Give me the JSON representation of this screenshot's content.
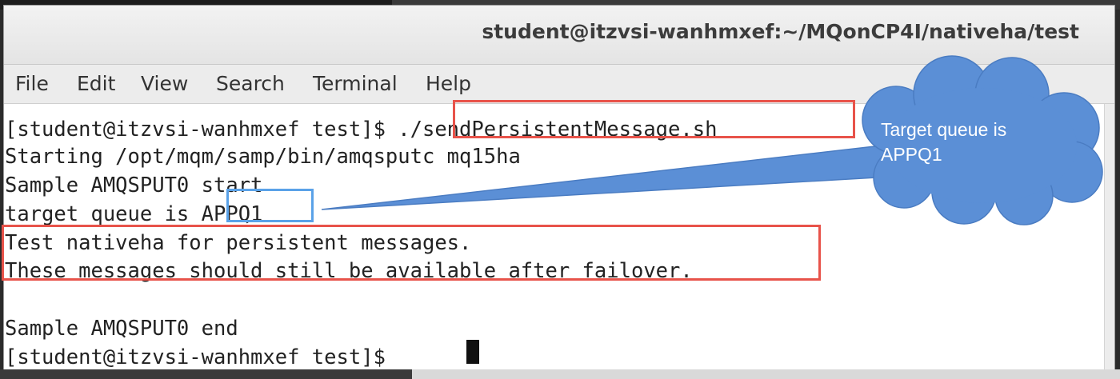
{
  "window": {
    "title": "student@itzvsi-wanhmxef:~/MQonCP4I/nativeha/test"
  },
  "menu": [
    "File",
    "Edit",
    "View",
    "Search",
    "Terminal",
    "Help"
  ],
  "terminal": {
    "lines": [
      "[student@itzvsi-wanhmxef test]$ ./sendPersistentMessage.sh",
      "Starting /opt/mqm/samp/bin/amqsputc mq15ha",
      "Sample AMQSPUT0 start",
      "target queue is APPQ1",
      "Test nativeha for persistent messages.",
      "These messages should still be available after failover.",
      "",
      "Sample AMQSPUT0 end",
      "[student@itzvsi-wanhmxef test]$ "
    ]
  },
  "callout": {
    "line1": "Target queue is",
    "line2": "APPQ1"
  },
  "colors": {
    "highlight_red": "#e8534a",
    "highlight_blue": "#5aa2e8",
    "callout_fill": "#5b8fd6"
  }
}
